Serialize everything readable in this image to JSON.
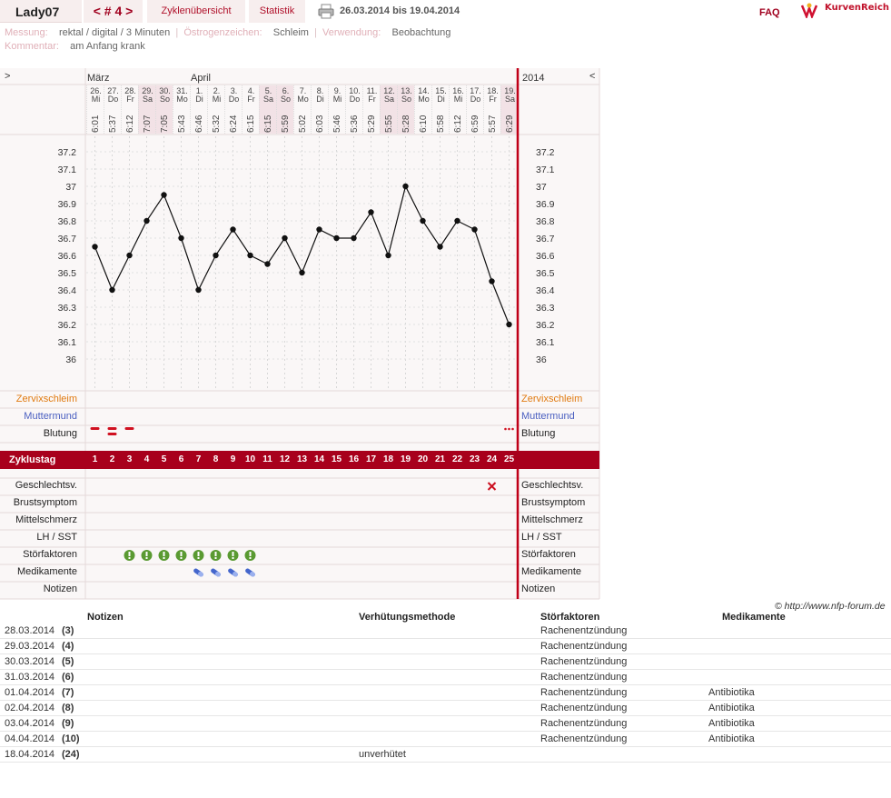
{
  "header": {
    "user": "Lady07",
    "cycle_nav": "< # 4 >",
    "tab_overview": "Zyklenübersicht",
    "tab_stats": "Statistik",
    "date_range": "26.03.2014 bis 19.04.2014",
    "faq": "FAQ",
    "logo": "KurvenReich"
  },
  "meta": {
    "messung_label": "Messung:",
    "messung_value": "rektal / digital / 3 Minuten",
    "oestrogen_label": "Östrogenzeichen:",
    "oestrogen_value": "Schleim",
    "verwendung_label": "Verwendung:",
    "verwendung_value": "Beobachtung",
    "kommentar_label": "Kommentar:",
    "kommentar_value": "am Anfang krank"
  },
  "chart": {
    "expand_left": ">",
    "expand_right": "<",
    "year": "2014",
    "month1": "März",
    "month2": "April",
    "days": [
      {
        "date": "26.",
        "dow": "Mi",
        "time": "6:01",
        "weekend": false
      },
      {
        "date": "27.",
        "dow": "Do",
        "time": "5:37",
        "weekend": false
      },
      {
        "date": "28.",
        "dow": "Fr",
        "time": "6:12",
        "weekend": false
      },
      {
        "date": "29.",
        "dow": "Sa",
        "time": "7:07",
        "weekend": true
      },
      {
        "date": "30.",
        "dow": "So",
        "time": "7:05",
        "weekend": true
      },
      {
        "date": "31.",
        "dow": "Mo",
        "time": "5:43",
        "weekend": false
      },
      {
        "date": "1.",
        "dow": "Di",
        "time": "6:46",
        "weekend": false
      },
      {
        "date": "2.",
        "dow": "Mi",
        "time": "5:32",
        "weekend": false
      },
      {
        "date": "3.",
        "dow": "Do",
        "time": "6:24",
        "weekend": false
      },
      {
        "date": "4.",
        "dow": "Fr",
        "time": "6:15",
        "weekend": false
      },
      {
        "date": "5.",
        "dow": "Sa",
        "time": "6:15",
        "weekend": true
      },
      {
        "date": "6.",
        "dow": "So",
        "time": "5:59",
        "weekend": true
      },
      {
        "date": "7.",
        "dow": "Mo",
        "time": "5:02",
        "weekend": false
      },
      {
        "date": "8.",
        "dow": "Di",
        "time": "6:03",
        "weekend": false
      },
      {
        "date": "9.",
        "dow": "Mi",
        "time": "5:46",
        "weekend": false
      },
      {
        "date": "10.",
        "dow": "Do",
        "time": "5:36",
        "weekend": false
      },
      {
        "date": "11.",
        "dow": "Fr",
        "time": "5:29",
        "weekend": false
      },
      {
        "date": "12.",
        "dow": "Sa",
        "time": "5:55",
        "weekend": true
      },
      {
        "date": "13.",
        "dow": "So",
        "time": "5:28",
        "weekend": true
      },
      {
        "date": "14.",
        "dow": "Mo",
        "time": "6:10",
        "weekend": false
      },
      {
        "date": "15.",
        "dow": "Di",
        "time": "5:58",
        "weekend": false
      },
      {
        "date": "16.",
        "dow": "Mi",
        "time": "6:12",
        "weekend": false
      },
      {
        "date": "17.",
        "dow": "Do",
        "time": "6:59",
        "weekend": false
      },
      {
        "date": "18.",
        "dow": "Fr",
        "time": "5:57",
        "weekend": false
      },
      {
        "date": "19.",
        "dow": "Sa",
        "time": "6:29",
        "weekend": true
      }
    ],
    "cycle_days": [
      "1",
      "2",
      "3",
      "4",
      "5",
      "6",
      "7",
      "8",
      "9",
      "10",
      "11",
      "12",
      "13",
      "14",
      "15",
      "16",
      "17",
      "18",
      "19",
      "20",
      "21",
      "22",
      "23",
      "24",
      "25"
    ],
    "row_labels": {
      "zervix": "Zervixschleim",
      "muttermund": "Muttermund",
      "blutung": "Blutung",
      "zyklustag": "Zyklustag",
      "gv": "Geschlechtsv.",
      "brust": "Brustsymptom",
      "mittel": "Mittelschmerz",
      "lh": "LH / SST",
      "stoer": "Störfaktoren",
      "medi": "Medikamente",
      "notizen": "Notizen"
    },
    "blutung_days": [
      1,
      2,
      3
    ],
    "spotting_days": [
      25
    ],
    "gv_days": [
      24
    ],
    "stoer_days": [
      3,
      4,
      5,
      6,
      7,
      8,
      9,
      10
    ],
    "medi_days": [
      7,
      8,
      9,
      10
    ],
    "colors": {
      "accent": "#a8001c",
      "zervix": "#e07a10",
      "muttermund": "#4a5fc0",
      "stoer": "#5a9a32",
      "medi": "#4466cc"
    },
    "copyright": "© http://www.nfp-forum.de"
  },
  "chart_data": {
    "type": "line",
    "x": [
      "26.03",
      "27.03",
      "28.03",
      "29.03",
      "30.03",
      "31.03",
      "01.04",
      "02.04",
      "03.04",
      "04.04",
      "05.04",
      "06.04",
      "07.04",
      "08.04",
      "09.04",
      "10.04",
      "11.04",
      "12.04",
      "13.04",
      "14.04",
      "15.04",
      "16.04",
      "17.04",
      "18.04",
      "19.04"
    ],
    "series": [
      {
        "values": [
          36.65,
          36.4,
          36.6,
          36.8,
          36.95,
          36.7,
          36.4,
          36.6,
          36.75,
          36.6,
          36.55,
          36.7,
          36.5,
          36.75,
          36.7,
          36.7,
          36.85,
          36.6,
          37.0,
          36.8,
          36.65,
          36.8,
          36.75,
          36.45,
          36.2
        ]
      }
    ],
    "yticks": [
      "37.2",
      "37.1",
      "37",
      "36.9",
      "36.8",
      "36.7",
      "36.6",
      "36.5",
      "36.4",
      "36.3",
      "36.2",
      "36.1",
      "36"
    ],
    "ylim": [
      36.0,
      37.2
    ],
    "grid": true
  },
  "notes": {
    "headers": {
      "notizen": "Notizen",
      "verhuetung": "Verhütungsmethode",
      "stoer": "Störfaktoren",
      "medi": "Medikamente"
    },
    "rows": [
      {
        "date": "28.03.2014",
        "day": "(3)",
        "verh": "",
        "stoer": "Rachenentzündung",
        "medi": ""
      },
      {
        "date": "29.03.2014",
        "day": "(4)",
        "verh": "",
        "stoer": "Rachenentzündung",
        "medi": ""
      },
      {
        "date": "30.03.2014",
        "day": "(5)",
        "verh": "",
        "stoer": "Rachenentzündung",
        "medi": ""
      },
      {
        "date": "31.03.2014",
        "day": "(6)",
        "verh": "",
        "stoer": "Rachenentzündung",
        "medi": ""
      },
      {
        "date": "01.04.2014",
        "day": "(7)",
        "verh": "",
        "stoer": "Rachenentzündung",
        "medi": "Antibiotika"
      },
      {
        "date": "02.04.2014",
        "day": "(8)",
        "verh": "",
        "stoer": "Rachenentzündung",
        "medi": "Antibiotika"
      },
      {
        "date": "03.04.2014",
        "day": "(9)",
        "verh": "",
        "stoer": "Rachenentzündung",
        "medi": "Antibiotika"
      },
      {
        "date": "04.04.2014",
        "day": "(10)",
        "verh": "",
        "stoer": "Rachenentzündung",
        "medi": "Antibiotika"
      },
      {
        "date": "18.04.2014",
        "day": "(24)",
        "verh": "unverhütet",
        "stoer": "",
        "medi": ""
      }
    ]
  }
}
